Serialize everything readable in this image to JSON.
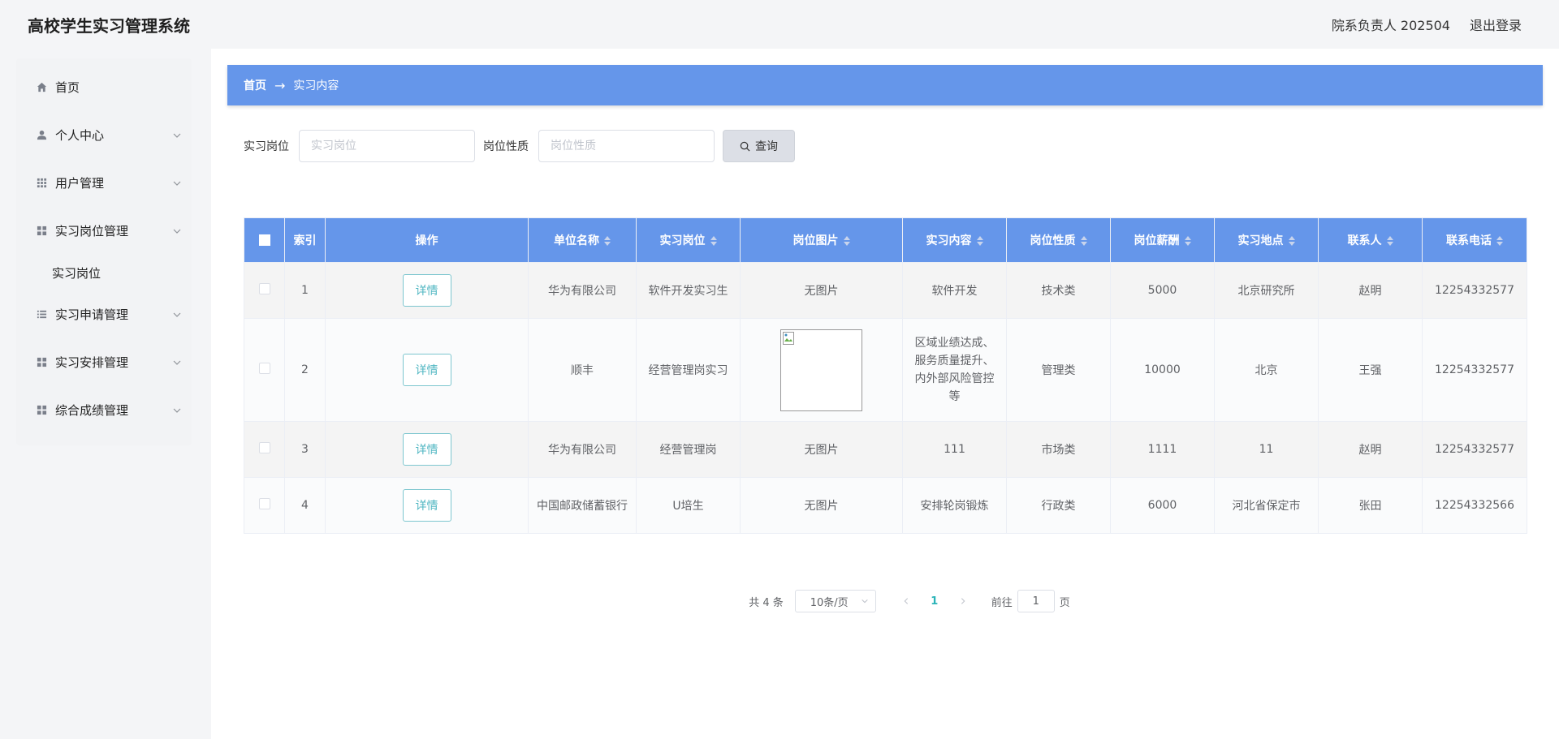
{
  "header": {
    "title": "高校学生实习管理系统",
    "user": "院系负责人 202504",
    "logout": "退出登录"
  },
  "sidebar": {
    "items": [
      {
        "label": "首页",
        "icon": "home-icon"
      },
      {
        "label": "个人中心",
        "icon": "user-icon"
      },
      {
        "label": "用户管理",
        "icon": "grid-icon"
      },
      {
        "label": "实习岗位管理",
        "icon": "apps-icon"
      },
      {
        "label": "实习申请管理",
        "icon": "list-icon"
      },
      {
        "label": "实习安排管理",
        "icon": "apps-icon"
      },
      {
        "label": "综合成绩管理",
        "icon": "apps-icon"
      }
    ],
    "sub_item": "实习岗位"
  },
  "breadcrumb": {
    "home": "首页",
    "sep": "→",
    "current": "实习内容"
  },
  "search": {
    "position_label": "实习岗位",
    "position_placeholder": "实习岗位",
    "nature_label": "岗位性质",
    "nature_placeholder": "岗位性质",
    "query_button": "查询"
  },
  "table": {
    "headers": [
      "索引",
      "操作",
      "单位名称",
      "实习岗位",
      "岗位图片",
      "实习内容",
      "岗位性质",
      "岗位薪酬",
      "实习地点",
      "联系人",
      "联系电话"
    ],
    "detail_label": "详情",
    "rows": [
      {
        "index": "1",
        "company": "华为有限公司",
        "position": "软件开发实习生",
        "image": "无图片",
        "content": "软件开发",
        "nature": "技术类",
        "salary": "5000",
        "location": "北京研究所",
        "contact": "赵明",
        "phone": "12254332577"
      },
      {
        "index": "2",
        "company": "顺丰",
        "position": "经营管理岗实习",
        "image": "",
        "content": "区域业绩达成、服务质量提升、内外部风险管控等",
        "nature": "管理类",
        "salary": "10000",
        "location": "北京",
        "contact": "王强",
        "phone": "12254332577"
      },
      {
        "index": "3",
        "company": "华为有限公司",
        "position": "经营管理岗",
        "image": "无图片",
        "content": "111",
        "nature": "市场类",
        "salary": "1111",
        "location": "11",
        "contact": "赵明",
        "phone": "12254332577"
      },
      {
        "index": "4",
        "company": "中国邮政储蓄银行",
        "position": "U培生",
        "image": "无图片",
        "content": "安排轮岗锻炼",
        "nature": "行政类",
        "salary": "6000",
        "location": "河北省保定市",
        "contact": "张田",
        "phone": "12254332566"
      }
    ]
  },
  "pagination": {
    "total": "共 4 条",
    "page_size": "10条/页",
    "current_page": "1",
    "goto_label": "前往",
    "goto_value": "1",
    "page_suffix": "页"
  }
}
